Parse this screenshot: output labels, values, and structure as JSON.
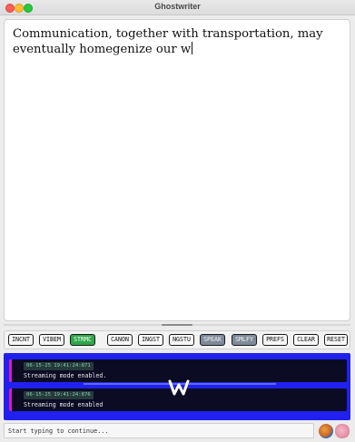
{
  "window": {
    "title": "Ghostwriter"
  },
  "editor": {
    "text": "Communication, together with transportation, may eventually homegenize our w"
  },
  "toolbar": {
    "buttons": [
      {
        "label": "INCNT",
        "state": "off"
      },
      {
        "label": "VIBEM",
        "state": "off"
      },
      {
        "label": "STRMC",
        "state": "on"
      },
      {
        "label": "CANON",
        "state": "off"
      },
      {
        "label": "INGST",
        "state": "off"
      },
      {
        "label": "NGSTU",
        "state": "off"
      },
      {
        "label": "SPEAK",
        "state": "grey"
      },
      {
        "label": "SMLFY",
        "state": "grey"
      },
      {
        "label": "PREFS",
        "state": "off"
      },
      {
        "label": "CLEAR",
        "state": "off"
      },
      {
        "label": "RESET",
        "state": "off"
      }
    ]
  },
  "console": {
    "entries": [
      {
        "timestamp": "06-15-25 19:41:24:871",
        "message": "Streaming mode enabled."
      },
      {
        "timestamp": "06-15-25 19:41:24:876",
        "message": "Streaming mode enabled"
      }
    ],
    "logo": "W"
  },
  "status": {
    "text": "Start typing to continue..."
  },
  "colors": {
    "active": "#2ea84a",
    "console_bg": "#2121ef",
    "log_accent": "#d81bbf",
    "disabled": "#7f8a99"
  }
}
